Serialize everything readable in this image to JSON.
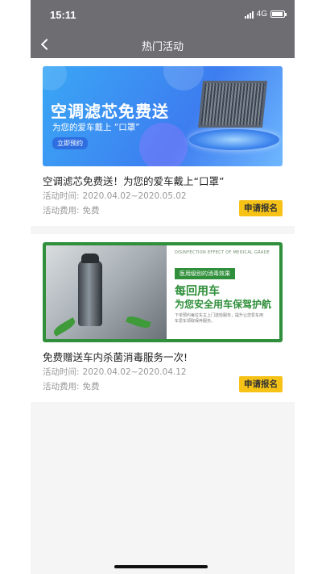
{
  "status_bar": {
    "time": "15:11",
    "network": "4G",
    "icons": [
      "signal-icon",
      "battery-icon"
    ]
  },
  "nav": {
    "title": "热门活动",
    "back_icon": "chevron-left-icon"
  },
  "labels": {
    "time_label": "活动时间:",
    "fee_label": "活动费用:",
    "signup": "申请报名"
  },
  "activities": [
    {
      "title": "空调滤芯免费送！为您的爱车戴上“口罩”",
      "time": "2020.04.02~2020.05.02",
      "fee": "免费",
      "banner": {
        "headline": "空调滤芯免费送",
        "subline": "为您的爱车戴上 “口罩”",
        "button": "立即预约"
      }
    },
    {
      "title": "免费赠送车内杀菌消毒服务一次!",
      "time": "2020.04.02~2020.04.12",
      "fee": "免费",
      "banner": {
        "header": "DISINFECTION EFFECT OF MEDICAL GRADE",
        "tag": "医用级别的消毒效果",
        "headline": "每回用车",
        "subline": "为您安全用车保驾护航",
        "desc": "下单预约每位车主上门送检服务，提升让您爱车用车爱车领取保养服务。"
      }
    }
  ],
  "colors": {
    "nav_bg": "#6d6d72",
    "accent_button": "#f6c215",
    "banner2_green": "#2f8f3a"
  }
}
